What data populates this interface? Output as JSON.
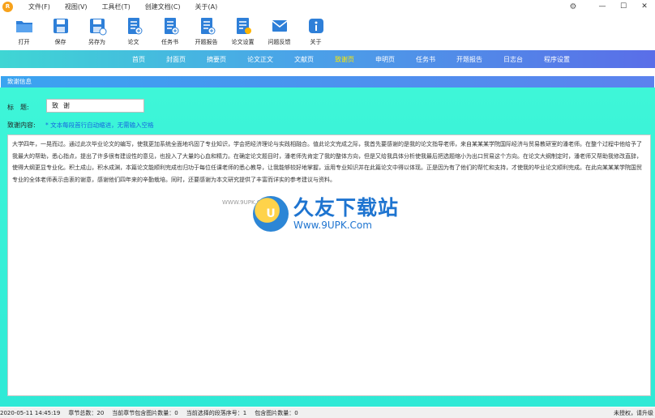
{
  "app": {
    "logo_text": "R"
  },
  "menu": [
    "文件(F)",
    "视图(V)",
    "工具栏(T)",
    "创建文档(C)",
    "关于(A)"
  ],
  "window_controls": {
    "minimize": "—",
    "maximize": "☐",
    "close": "✕"
  },
  "toolbar": [
    {
      "label": "打开",
      "icon": "folder-icon",
      "color": "#2e7fd8"
    },
    {
      "label": "保存",
      "icon": "save-icon",
      "color": "#2e7fd8"
    },
    {
      "label": "另存为",
      "icon": "save-as-icon",
      "color": "#2e7fd8"
    },
    {
      "label": "论文",
      "icon": "paper-icon",
      "color": "#2e7fd8"
    },
    {
      "label": "任务书",
      "icon": "task-book-icon",
      "color": "#2e7fd8"
    },
    {
      "label": "开题报告",
      "icon": "proposal-icon",
      "color": "#2e7fd8"
    },
    {
      "label": "论文设置",
      "icon": "settings-doc-icon",
      "color": "#2e7fd8"
    },
    {
      "label": "问题反馈",
      "icon": "feedback-mail-icon",
      "color": "#2e7fd8"
    },
    {
      "label": "关于",
      "icon": "info-icon",
      "color": "#2e7fd8"
    }
  ],
  "nav": {
    "tabs": [
      "首页",
      "封面页",
      "摘要页",
      "论文正文",
      "文献页",
      "致谢页",
      "申明页",
      "任务书",
      "开题报告",
      "日志台",
      "程序设置"
    ],
    "active": "致谢页",
    "active_color": "#ffea00"
  },
  "panel": {
    "header": "致谢信息"
  },
  "form": {
    "title_label": "标　题:",
    "title_value": "致谢",
    "content_label": "致谢内容:",
    "content_hint": "* 文本每段首行自动缩进，无需输入空格",
    "content_text": "大学四年，一晃而过。通过此次毕业论文的编写，使我更加系统全面地巩固了专业知识，学会把经济理论与实践相融合。值此论文完成之际，我首先要感谢的是我的论文指导老师，来自某某某学院国际经济与贸易教研室的潘老师。在整个过程中他给予了我最大的帮助，悉心指点，提出了许多很有建设性的意见，也投入了大量的心血和精力。在确定论文题目时，潘老师先肯定了我的整体方向，但是又给我具体分析使我最后把选题缩小为出口贸易这个方向。在论文大纲制定时，潘老师又帮助我修改直辞，使得大纲更显专业化。积土成山，积水成渊，本篇论文能顺利完成也归功于每位任课老师的悉心教导，让我能够较好地掌握，运用专业知识并在此篇论文中得以体现。正是因为有了他们的帮忙和支持，才使我的毕业论文顺利完成。在此向某某某学院国贸专业的全体老师表示由衷的谢意，感谢他们四年来的辛勤栽培。同时，还要感谢为本文研究提供了丰富而详实的参考建议与资料。"
  },
  "watermark": {
    "cn": "久友下载站",
    "url": "Www.9UPK.Com",
    "small": "WWW.9UPK.COM"
  },
  "status": {
    "datetime": "2020-05-11 14:45:19",
    "chapter_count": "章节总数：20",
    "image_count": "当前章节包含图片数量：0",
    "selected_para": "当前选择的段落序号：1",
    "para_images": "包含图片数量：0",
    "right": "未授权，请升级"
  }
}
